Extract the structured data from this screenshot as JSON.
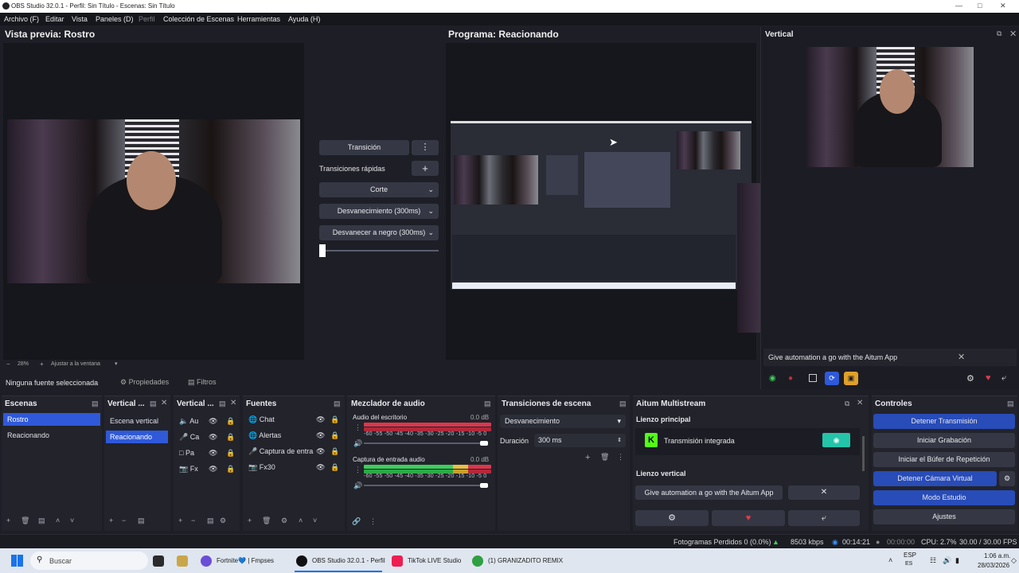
{
  "titlebar": {
    "title": "OBS Studio 32.0.1 - Perfil: Sin Título - Escenas: Sin Título"
  },
  "menu": {
    "items": [
      "Archivo (F)",
      "Editar",
      "Vista",
      "Paneles (D)",
      "Perfil",
      "Colección de Escenas",
      "Herramientas",
      "Ayuda (H)"
    ]
  },
  "preview": {
    "title": "Vista previa: Rostro",
    "zoom": "28%",
    "fit_label": "Ajustar a la ventana"
  },
  "program": {
    "title": "Programa: Reacionando"
  },
  "transitions_mid": {
    "transition_button": "Transición",
    "quick_label": "Transiciones rápidas",
    "options": [
      "Corte",
      "Desvanecimiento (300ms)",
      "Desvanecer a negro (300ms)"
    ]
  },
  "vertical": {
    "title": "Vertical",
    "banner": "Give automation a go with the Aitum App"
  },
  "source_toolbar": {
    "no_source": "Ninguna fuente seleccionada",
    "properties": "Propiedades",
    "filters": "Filtros"
  },
  "docks": {
    "scenes": {
      "title": "Escenas",
      "items": [
        "Rostro",
        "Reacionando"
      ]
    },
    "vertical_scenes": {
      "title": "Vertical ...",
      "items": [
        "Escena vertical",
        "Reacionando"
      ]
    },
    "vertical_sources": {
      "title": "Vertical ...",
      "items": [
        "Au",
        "Ca",
        "Pa",
        "Fx"
      ]
    },
    "sources": {
      "title": "Fuentes",
      "items": [
        "Chat",
        "Alertas",
        "Captura de entra",
        "Fx30"
      ]
    },
    "mixer": {
      "title": "Mezclador de audio",
      "channels": [
        {
          "name": "Audio del escritorio",
          "db": "0.0 dB"
        },
        {
          "name": "Captura de entrada audio",
          "db": "0.0 dB"
        }
      ],
      "scale": "-60 -55 -50 -45 -40 -35 -30 -25 -20 -15 -10 -5 0"
    },
    "scene_transitions": {
      "title": "Transiciones de escena",
      "selected": "Desvanecimiento",
      "duration_label": "Duración",
      "duration_value": "300 ms"
    },
    "aitum": {
      "title": "Aitum Multistream",
      "main_canvas": "Lienzo principal",
      "integrated": "Transmisión integrada",
      "vertical_canvas": "Lienzo vertical",
      "banner": "Give automation a go with the Aitum App"
    },
    "controls": {
      "title": "Controles",
      "buttons": [
        "Detener Transmisión",
        "Iniciar Grabación",
        "Iniciar el Búfer de Repetición",
        "Detener Cámara Virtual",
        "Modo Estudio",
        "Ajustes"
      ]
    }
  },
  "status": {
    "dropped": "Fotogramas Perdidos 0 (0.0%)",
    "bitrate": "8503 kbps",
    "live_time": "00:14:21",
    "rec_time": "00:00:00",
    "cpu": "CPU: 2.7%",
    "fps": "30.00 / 30.00 FPS"
  },
  "taskbar": {
    "search": "Buscar",
    "apps": [
      "Fortnite💙 | Fmpses",
      "OBS Studio 32.0.1 - Perfil",
      "TikTok LIVE Studio",
      "(1) GRANIZADITO REMIX"
    ],
    "lang": "ESP",
    "lang_sub": "ES",
    "time": "1:06 a.m.",
    "date": "28/03/2026"
  },
  "colors": {
    "accent": "#2f59d9",
    "button_blue": "#284cb8",
    "bg": "#1e1f26",
    "meter_red": "#e0354a",
    "meter_green": "#3ccf5a"
  }
}
